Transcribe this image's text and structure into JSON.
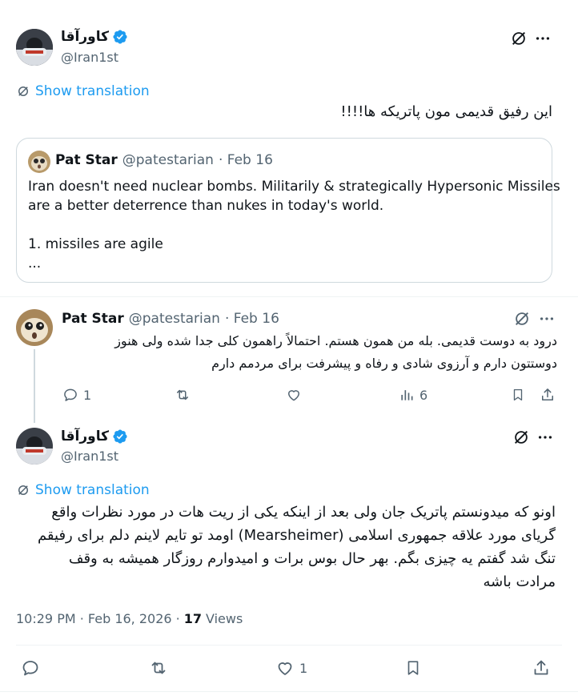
{
  "tweet1": {
    "display_name": "کاورآقا",
    "handle": "@Iran1st",
    "show_translation": "Show translation",
    "text": "این رفیق قدیمی مون پاتریکه ها!!!!",
    "quote": {
      "display_name": "Pat Star",
      "handle": "@patestarian",
      "date": "· Feb 16",
      "line1": "Iran doesn't need nuclear bombs. Militarily & strategically Hypersonic Missiles",
      "line2": "are a better deterrence than nukes in today's world.",
      "line3": "1. missiles are agile",
      "line4": "..."
    }
  },
  "reply": {
    "display_name": "Pat Star",
    "handle": "@patestarian",
    "date": "· Feb 16",
    "line1": "درود به دوست قدیمی. بله من همون هستم. احتمالاً راهمون کلی جدا شده ولی هنوز",
    "line2": "دوستتون دارم و آرزوی شادی و رفاه و پیشرفت برای مردمم دارم",
    "replies": "1",
    "views": "6"
  },
  "tweet2": {
    "display_name": "کاورآقا",
    "handle": "@Iran1st",
    "show_translation": "Show translation",
    "line1": "اونو که میدونستم پاتریک جان ولی بعد از اینکه یکی از ریت هات در مورد نظرات واقع",
    "line2": "گریای مورد علاقه جمهوری اسلامی (Mearsheimer) اومد تو تایم لاینم دلم برای رفیقم",
    "line3": "تنگ شد گفتم یه چیزی بگم. بهر حال بوس برات و امیدوارم روزگار همیشه به وقف",
    "line4": "مرادت باشه",
    "timestamp": "10:29 PM · Feb 16, 2026 ·",
    "views_count": "17",
    "views_label": "Views",
    "likes": "1"
  },
  "icons": {
    "more": "more-icon",
    "grok": "grok-icon",
    "translate": "translate-icon",
    "reply": "reply-icon",
    "retweet": "retweet-icon",
    "like": "like-icon",
    "views": "views-icon",
    "bookmark": "bookmark-icon",
    "share": "share-icon",
    "verified": "verified-badge-icon"
  },
  "colors": {
    "accent": "#1d9bf0",
    "text": "#0f1419",
    "muted": "#536471",
    "border": "#cfd9de"
  }
}
